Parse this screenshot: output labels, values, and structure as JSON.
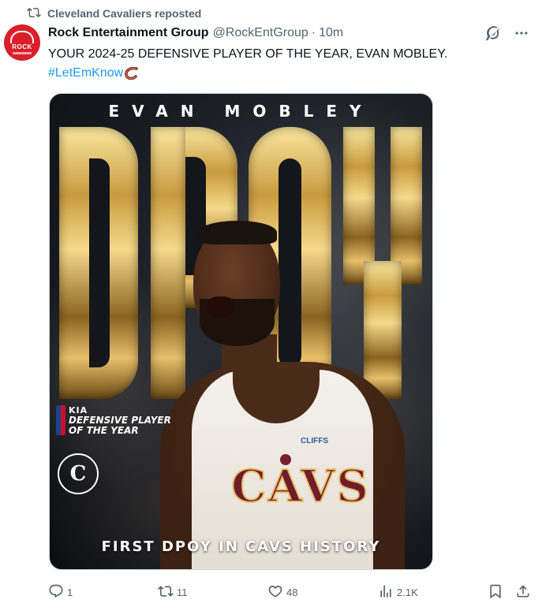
{
  "repost": {
    "label": "Cleveland Cavaliers reposted"
  },
  "author": {
    "avatar_text": "ROCK",
    "name": "Rock Entertainment Group",
    "handle": "@RockEntGroup",
    "separator": "·",
    "time": "10m"
  },
  "tweet": {
    "text": "YOUR 2024-25 DEFENSIVE PLAYER OF THE YEAR, EVAN MOBLEY.",
    "hashtag": "#LetEmKnow"
  },
  "media": {
    "player_name": "EVAN MOBLEY",
    "big_word": "DPOY",
    "award_brand": "KIA",
    "award_line1": "DEFENSIVE PLAYER",
    "award_line2": "OF THE YEAR",
    "sponsor": "CLIFFS",
    "jersey_text": "CAVS",
    "team_mark": "C",
    "caption": "FIRST DPOY IN CAVS HISTORY"
  },
  "actions": {
    "replies": "1",
    "reposts": "11",
    "likes": "48",
    "views": "2.1K"
  },
  "colors": {
    "accent": "#1d9bf0",
    "secondary_text": "#536471",
    "avatar_bg": "#d81f2a"
  }
}
